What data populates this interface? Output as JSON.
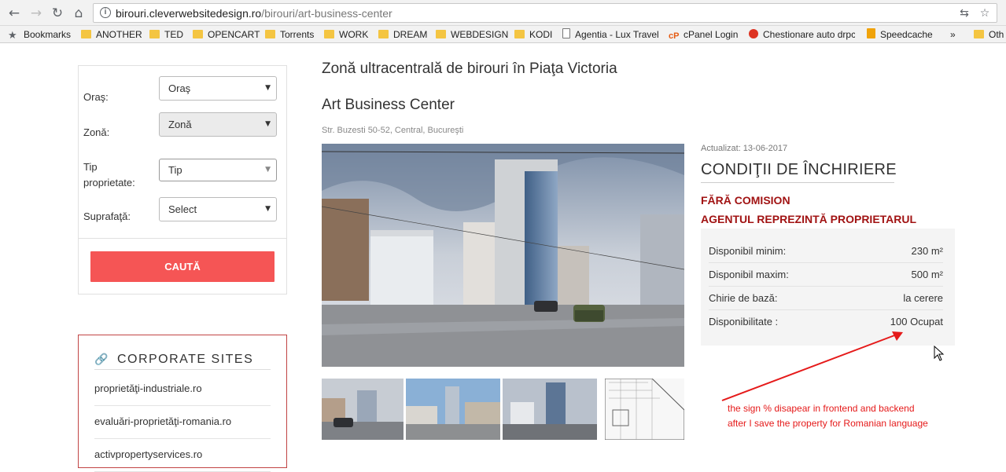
{
  "browser": {
    "url_host": "birouri.cleverwebsitedesign.ro",
    "url_path": "/birouri/art-business-center",
    "bookmarks": [
      "Bookmarks",
      "ANOTHER",
      "TED",
      "OPENCART",
      "Torrents",
      "WORK",
      "DREAM",
      "WEBDESIGN",
      "KODI",
      "Agentia - Lux Travel",
      "cPanel Login",
      "Chestionare auto drpc",
      "Speedcache",
      "»",
      "Oth"
    ]
  },
  "search": {
    "city_label": "Oraş:",
    "city_value": "Oraş",
    "zone_label": "Zonă:",
    "zone_value": "Zonă",
    "type_label_1": "Tip",
    "type_label_2": "proprietate:",
    "type_value": "Tip",
    "area_label": "Suprafaţă:",
    "area_value": "Select",
    "button": "CAUTĂ"
  },
  "corporate": {
    "title": "CORPORATE SITES",
    "links": [
      "proprietăţi-industriale.ro",
      "evaluări-proprietăţi-romania.ro",
      "activpropertyservices.ro"
    ]
  },
  "main": {
    "headline": "Zonă ultracentrală de birouri în Piaţa Victoria",
    "property_name": "Art Business Center",
    "address": "Str. Buzesti 50-52, Central, Bucureşti"
  },
  "conditions": {
    "updated": "Actualizat: 13-06-2017",
    "title": "CONDIŢII DE ÎNCHIRIERE",
    "no_commission": "FĂRĂ COMISION",
    "agent": "AGENTUL REPREZINTĂ PROPRIETARUL",
    "rows": [
      {
        "key": "Disponibil minim:",
        "value": "230 m²"
      },
      {
        "key": "Disponibil maxim:",
        "value": "500 m²"
      },
      {
        "key": "Chirie de bază:",
        "value": "la cerere"
      },
      {
        "key": "Disponibilitate :",
        "value": "100 Ocupat"
      }
    ]
  },
  "annotation": {
    "line1": "the sign % disapear in frontend and backend",
    "line2": "after I save the property for Romanian language",
    "color": "#e51a1a"
  }
}
